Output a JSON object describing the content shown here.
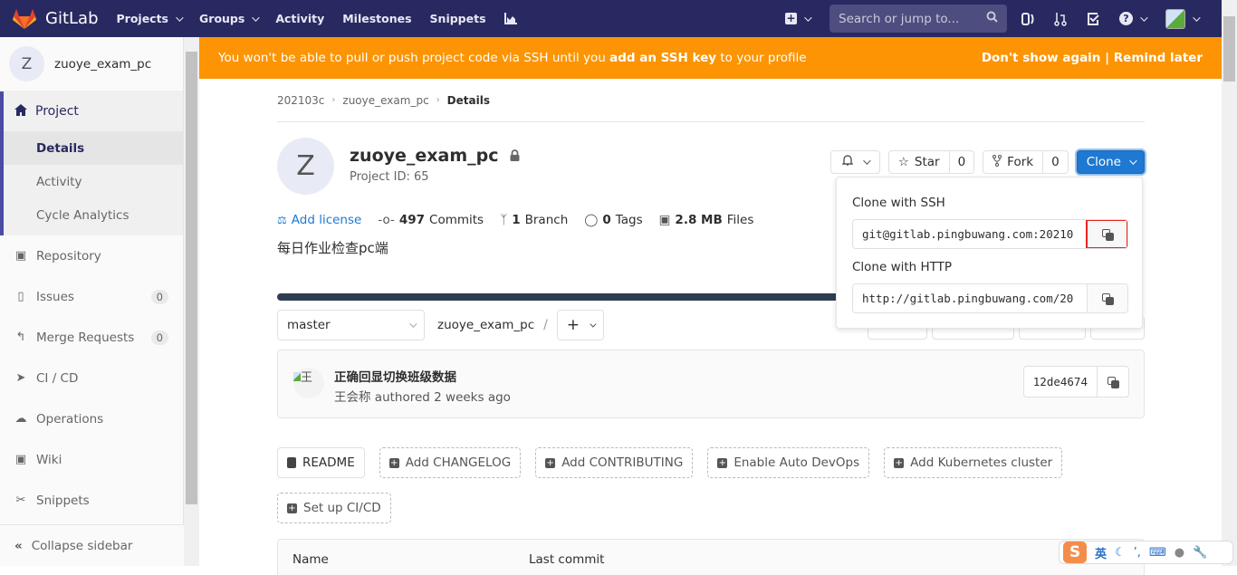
{
  "navbar": {
    "brand": "GitLab",
    "items": [
      {
        "label": "Projects",
        "has_dropdown": true
      },
      {
        "label": "Groups",
        "has_dropdown": true
      },
      {
        "label": "Activity"
      },
      {
        "label": "Milestones"
      },
      {
        "label": "Snippets"
      }
    ],
    "search_placeholder": "Search or jump to...",
    "icons": [
      "chart-icon",
      "plus-square-icon",
      "issues-icon",
      "merge-request-icon",
      "todo-icon",
      "help-icon",
      "user-avatar"
    ]
  },
  "sidebar": {
    "project_initial": "Z",
    "project_name": "zuoye_exam_pc",
    "section": {
      "label": "Project",
      "subitems": [
        {
          "label": "Details",
          "active": true
        },
        {
          "label": "Activity"
        },
        {
          "label": "Cycle Analytics"
        }
      ]
    },
    "items": [
      {
        "label": "Repository",
        "icon": "doc-icon"
      },
      {
        "label": "Issues",
        "icon": "issues-icon",
        "count": "0"
      },
      {
        "label": "Merge Requests",
        "icon": "merge-request-icon",
        "count": "0"
      },
      {
        "label": "CI / CD",
        "icon": "rocket-icon"
      },
      {
        "label": "Operations",
        "icon": "cloud-gear-icon"
      },
      {
        "label": "Wiki",
        "icon": "book-icon"
      },
      {
        "label": "Snippets",
        "icon": "scissors-icon"
      }
    ],
    "collapse_label": "Collapse sidebar"
  },
  "banner": {
    "text_before": "You won't be able to pull or push project code via SSH until you ",
    "link": "add an SSH key",
    "text_after": " to your profile",
    "dont_show": "Don't show again",
    "separator": "|",
    "remind": "Remind later",
    "color": "#fc9403"
  },
  "breadcrumb": [
    "202103c",
    "zuoye_exam_pc",
    "Details"
  ],
  "project": {
    "initial": "Z",
    "name": "zuoye_exam_pc",
    "visibility": "private",
    "id_label": "Project ID: 65",
    "star_label": "Star",
    "star_count": "0",
    "fork_label": "Fork",
    "fork_count": "0",
    "clone_label": "Clone",
    "stats": {
      "license": "Add license",
      "commits_num": "497",
      "commits_label": "Commits",
      "branch_num": "1",
      "branch_label": "Branch",
      "tags_num": "0",
      "tags_label": "Tags",
      "files_size": "2.8 MB",
      "files_label": "Files"
    },
    "description": "每日作业检查pc端"
  },
  "clone_dropdown": {
    "ssh_label": "Clone with SSH",
    "ssh_url": "git@gitlab.pingbuwang.com:20210",
    "http_label": "Clone with HTTP",
    "http_url": "http://gitlab.pingbuwang.com/20"
  },
  "tree": {
    "branch": "master",
    "path": "zuoye_exam_pc",
    "separator": "/"
  },
  "last_commit": {
    "avatar_alt": "王",
    "title": "正确回显切换班级数据",
    "author": "王会称",
    "meta": " authored 2 weeks ago",
    "sha": "12de4674"
  },
  "quick_actions": [
    {
      "label": "README",
      "style": "solid",
      "icon": "doc-icon"
    },
    {
      "label": "Add CHANGELOG",
      "style": "dashed",
      "icon": "plus-square-icon"
    },
    {
      "label": "Add CONTRIBUTING",
      "style": "dashed",
      "icon": "plus-square-icon"
    },
    {
      "label": "Enable Auto DevOps",
      "style": "dashed",
      "icon": "plus-square-icon"
    },
    {
      "label": "Add Kubernetes cluster",
      "style": "dashed",
      "icon": "plus-square-icon"
    },
    {
      "label": "Set up CI/CD",
      "style": "dashed",
      "icon": "plus-square-icon"
    }
  ],
  "file_table": {
    "columns": [
      "Name",
      "Last commit"
    ]
  },
  "ime_toolbar": {
    "logo": "S",
    "lang": "英"
  }
}
